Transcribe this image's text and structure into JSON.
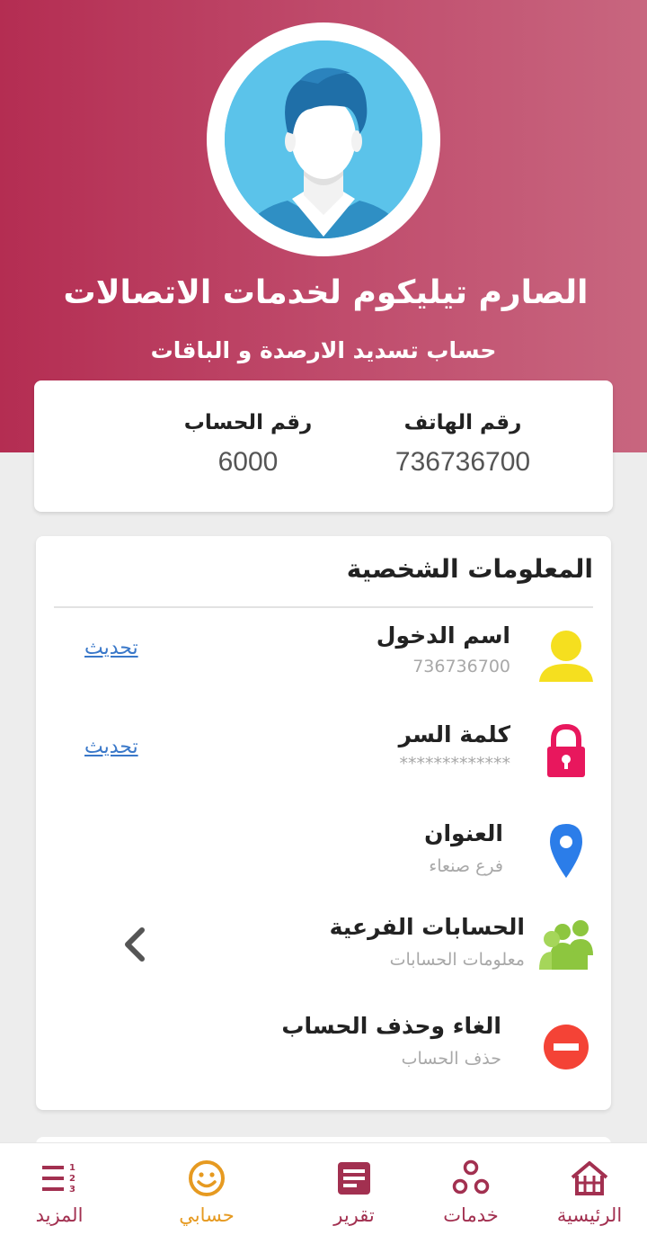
{
  "profile": {
    "company_name": "الصارم تيليكوم لخدمات الاتصالات",
    "account_type": "حساب تسديد الارصدة و الباقات"
  },
  "summary": {
    "phone_label": "رقم الهاتف",
    "phone_value": "736736700",
    "account_label": "رقم الحساب",
    "account_value": "6000"
  },
  "personal": {
    "title": "المعلومات الشخصية",
    "rows": [
      {
        "title": "اسم الدخول",
        "subtitle": "736736700",
        "action": "تحديث",
        "icon": "user-icon"
      },
      {
        "title": "كلمة السر",
        "subtitle": "*************",
        "action": "تحديث",
        "icon": "lock-icon"
      },
      {
        "title": "العنوان",
        "subtitle": "فرع صنعاء",
        "icon": "location-pin-icon"
      },
      {
        "title": "الحسابات الفرعية",
        "subtitle": "معلومات الحسابات",
        "icon": "users-group-icon"
      },
      {
        "title": "الغاء وحذف الحساب",
        "subtitle": "حذف الحساب",
        "icon": "delete-icon"
      }
    ]
  },
  "nav": {
    "items": [
      {
        "label": "الرئيسية",
        "icon": "home-icon"
      },
      {
        "label": "خدمات",
        "icon": "services-icon"
      },
      {
        "label": "تقرير",
        "icon": "report-icon"
      },
      {
        "label": "حسابي",
        "icon": "smiley-icon",
        "active": true
      },
      {
        "label": "المزيد",
        "icon": "menu-list-icon"
      }
    ]
  },
  "colors": {
    "header_start": "#b42d52",
    "header_end": "#c8667f",
    "nav_active": "#e69a21",
    "nav_inactive": "#a23050",
    "link": "#3a78c9"
  }
}
